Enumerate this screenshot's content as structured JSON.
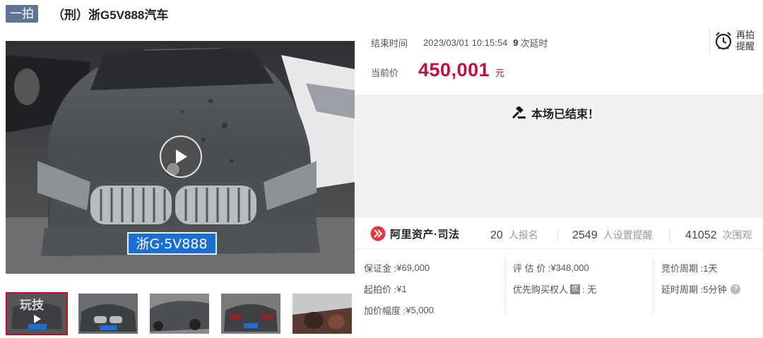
{
  "title": {
    "badge": "一拍",
    "text": "（刑）浙G5V888汽车"
  },
  "auction": {
    "end_label": "结束时间",
    "end_time": "2023/03/01 10:15:54",
    "delay_count": "9",
    "delay_label": "次延时",
    "price_label": "当前价",
    "price": "450,001",
    "price_unit": "元",
    "remind_label": "再拍提醒",
    "ended_message": "本场已结束！"
  },
  "stats": {
    "brand": "阿里资产·司法",
    "registered_count": "20",
    "registered_label": "人报名",
    "reminder_count": "2549",
    "reminder_label": "人设置提醒",
    "view_count": "41052",
    "view_label": "次围观"
  },
  "details": {
    "deposit_label": "保证金 : ",
    "deposit_value": "¥69,000",
    "start_price_label": "起拍价 : ",
    "start_price_value": "¥1",
    "increment_label": "加价幅度 : ",
    "increment_value": "¥5,000",
    "appraisal_label": "评 估 价 : ",
    "appraisal_value": "¥348,000",
    "priority_label": "优先购买权人",
    "priority_badge": "优",
    "priority_value": " : 无",
    "bid_cycle_label": "竞价周期 : ",
    "bid_cycle_value": "1天",
    "delay_cycle_label": "延时周期 : ",
    "delay_cycle_value": "5分钟"
  },
  "media": {
    "plate_text": "浙G·5V888",
    "thumb_watermark": "玩技",
    "thumbnails": [
      "video-thumb",
      "front-view",
      "side-view",
      "rear-view",
      "interior-view"
    ]
  },
  "colors": {
    "price": "#c40e3a",
    "badge_bg": "#5f7394",
    "active_thumb_border": "#d0021b",
    "ended_bg": "#f1f1f1"
  }
}
